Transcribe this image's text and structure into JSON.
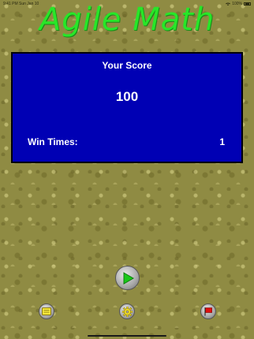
{
  "status_bar": {
    "time": "9:41 PM",
    "date": "Sun Jan 10",
    "battery": "100%"
  },
  "app": {
    "title": "Agile Math"
  },
  "score_panel": {
    "title": "Your Score",
    "score": "100",
    "wins_label": "Win Times:",
    "wins_value": "1"
  },
  "controls": {
    "play_icon": "play-icon",
    "menu_icon": "menu-icon",
    "settings_icon": "gear-icon",
    "flag_icon": "flag-icon"
  },
  "colors": {
    "title_green": "#28e628",
    "panel_blue": "#0000b4",
    "background_olive": "#8f8b43",
    "play_green": "#19c819",
    "flag_red": "#e01010",
    "menu_yellow": "#f5e73a",
    "gear_yellow": "#f5e12a"
  }
}
